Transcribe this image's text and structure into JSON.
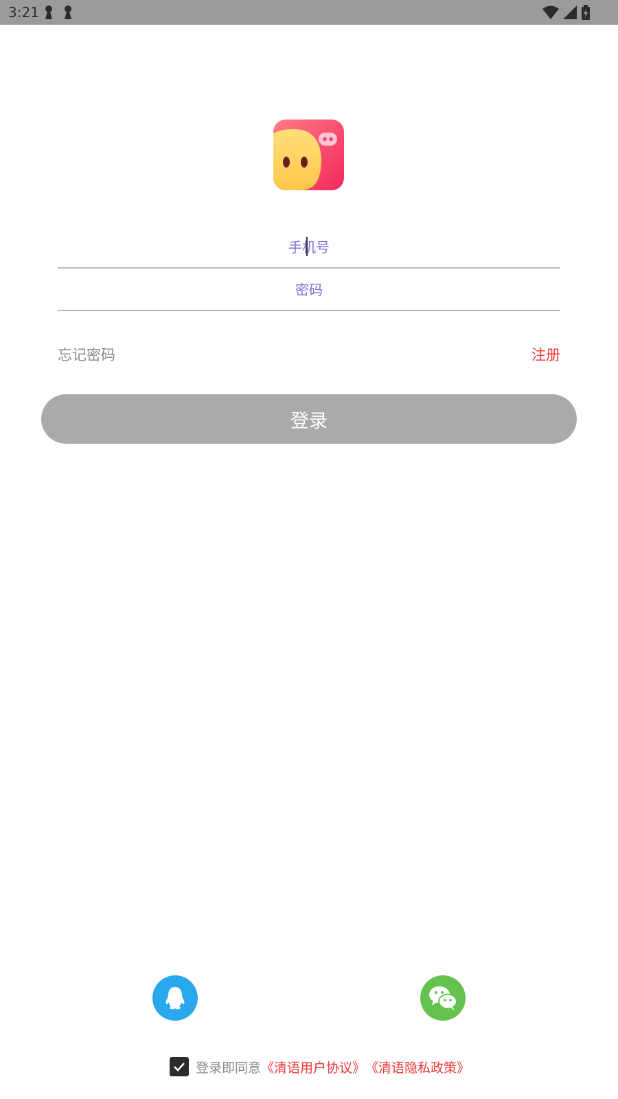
{
  "status_bar": {
    "time": "3:21",
    "left_icons": [
      "notification-icon",
      "notification-icon"
    ],
    "right_icons": [
      "wifi-icon",
      "signal-icon",
      "battery-icon"
    ]
  },
  "app": {
    "logo_icon": "app-logo-icon"
  },
  "form": {
    "phone_placeholder": "手机号",
    "phone_value": "",
    "password_placeholder": "密码",
    "password_value": "",
    "forgot_label": "忘记密码",
    "register_label": "注册",
    "login_label": "登录"
  },
  "social": {
    "qq_icon": "qq-icon",
    "wechat_icon": "wechat-icon"
  },
  "agreement": {
    "checked": true,
    "prefix": "登录即同意",
    "user_agreement": "《清语用户协议》",
    "privacy_policy": "《清语隐私政策》"
  },
  "colors": {
    "status_bar": "#9b9b9b",
    "placeholder": "#7a73d9",
    "accent_red": "#f0383a",
    "login_button": "#aaaaaa",
    "qq_blue": "#2aa8ed",
    "wechat_green": "#66c24e"
  }
}
